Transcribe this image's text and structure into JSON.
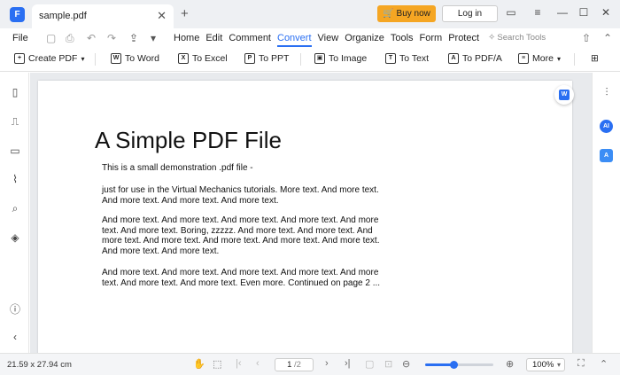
{
  "titlebar": {
    "logo": "F",
    "tab_name": "sample.pdf",
    "tab_close": "✕",
    "new_tab": "+",
    "buy_label": "Buy now",
    "login_label": "Log in",
    "icons": [
      "cart-icon",
      "message-icon",
      "menu-icon",
      "minimize-icon",
      "maximize-icon",
      "close-icon"
    ]
  },
  "menubar": {
    "file_label": "File",
    "items": [
      "Home",
      "Edit",
      "Comment",
      "Convert",
      "View",
      "Organize",
      "Tools",
      "Form",
      "Protect"
    ],
    "active_item": "Convert",
    "search_placeholder": "Search Tools"
  },
  "toolbar": {
    "items": [
      {
        "label": "Create PDF",
        "icon": "create-pdf-icon",
        "glyph": "+"
      },
      {
        "label": "To Word",
        "icon": "word-icon",
        "glyph": "W"
      },
      {
        "label": "To Excel",
        "icon": "excel-icon",
        "glyph": "X"
      },
      {
        "label": "To PPT",
        "icon": "ppt-icon",
        "glyph": "P"
      },
      {
        "label": "To Image",
        "icon": "image-icon",
        "glyph": "▣"
      },
      {
        "label": "To Text",
        "icon": "text-icon",
        "glyph": "T"
      },
      {
        "label": "To PDF/A",
        "icon": "pdfa-icon",
        "glyph": "A"
      },
      {
        "label": "More",
        "icon": "more-icon",
        "glyph": "≡"
      }
    ]
  },
  "document": {
    "title": "A Simple PDF File",
    "paragraphs": [
      "This is a small demonstration .pdf file -",
      "just for use in the Virtual Mechanics tutorials. More text. And more text. And more text. And more text. And more text.",
      "And more text. And more text. And more text. And more text. And more text. And more text. Boring, zzzzz. And more text. And more text. And more text. And more text. And more text. And more text. And more text. And more text. And more text.",
      "And more text. And more text. And more text. And more text. And more text. And more text. And more text. Even more. Continued on page 2 ..."
    ]
  },
  "statusbar": {
    "page_size": "21.59 x 27.94 cm",
    "current_page": "1",
    "total_pages": "/2",
    "zoom": "100%",
    "zoom_fraction": 0.42
  },
  "colors": {
    "accent": "#2a6ff2",
    "buy_button": "#f5a623"
  }
}
